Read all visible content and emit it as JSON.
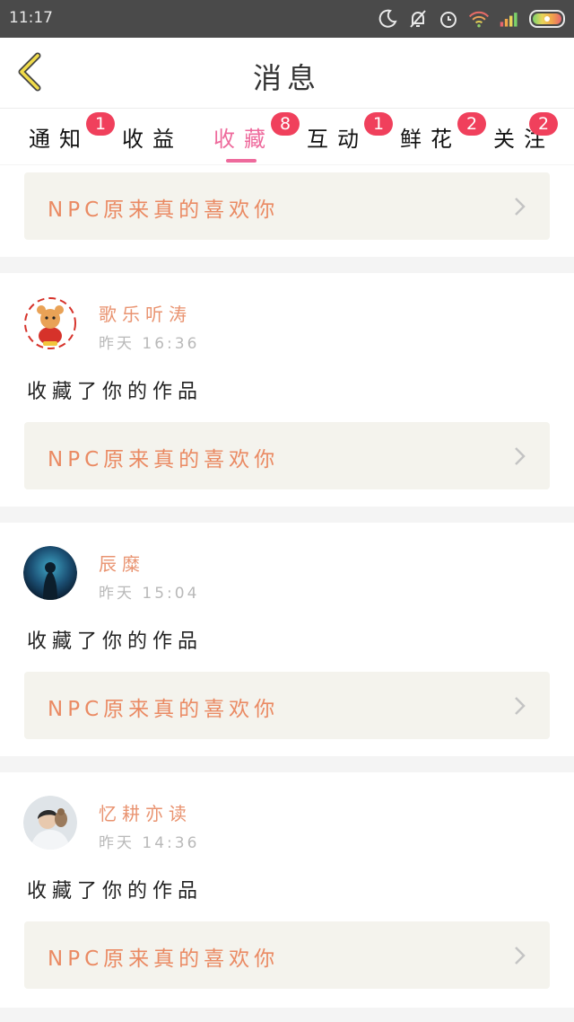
{
  "status_bar": {
    "time": "11:17",
    "icons": [
      "moon-icon",
      "bell-off-icon",
      "alarm-icon",
      "wifi-icon",
      "signal-icon",
      "battery-icon"
    ]
  },
  "header": {
    "title": "消息",
    "back_icon": "chevron-left-icon"
  },
  "tabs": [
    {
      "label": "通知",
      "badge": "1"
    },
    {
      "label": "收益",
      "badge": ""
    },
    {
      "label": "收藏",
      "badge": "8",
      "active": true
    },
    {
      "label": "互动",
      "badge": "1"
    },
    {
      "label": "鲜花",
      "badge": "2"
    },
    {
      "label": "关注",
      "badge": "2"
    }
  ],
  "colors": {
    "accent": "#ee6a9c",
    "badge": "#f0405c",
    "username": "#e99370",
    "work_title": "#ea8a63",
    "work_bg": "#f4f3ed"
  },
  "messages": [
    {
      "work_title": "NPC原来真的喜欢你"
    },
    {
      "username": "歌乐听涛",
      "time": "昨天 16:36",
      "action": "收藏了你的作品",
      "work_title": "NPC原来真的喜欢你"
    },
    {
      "username": "辰糜",
      "time": "昨天 15:04",
      "action": "收藏了你的作品",
      "work_title": "NPC原来真的喜欢你"
    },
    {
      "username": "忆耕亦读",
      "time": "昨天 14:36",
      "action": "收藏了你的作品",
      "work_title": "NPC原来真的喜欢你"
    }
  ]
}
